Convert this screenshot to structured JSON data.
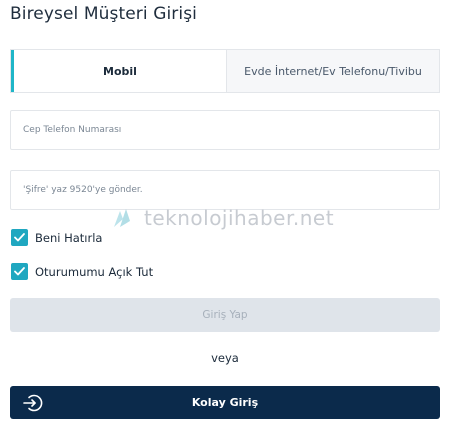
{
  "header": {
    "title": "Bireysel Müşteri Girişi"
  },
  "tabs": [
    {
      "label": "Mobil",
      "active": true
    },
    {
      "label": "Evde İnternet/Ev Telefonu/Tivibu",
      "active": false
    }
  ],
  "form": {
    "phone_placeholder": "Cep Telefon Numarası",
    "password_placeholder": "'Şifre' yaz 9520'ye gönder.",
    "remember_label": "Beni Hatırla",
    "remember_checked": true,
    "keep_session_label": "Oturumumu Açık Tut",
    "keep_session_checked": true,
    "login_button_label": "Giriş Yap",
    "or_label": "veya",
    "easy_login_label": "Kolay Giriş"
  },
  "watermark": {
    "text": "teknolojihaber.net"
  },
  "colors": {
    "accent": "#1fa7c0",
    "primary_button": "#0b2a4b",
    "disabled_button": "#dfe4ea"
  }
}
